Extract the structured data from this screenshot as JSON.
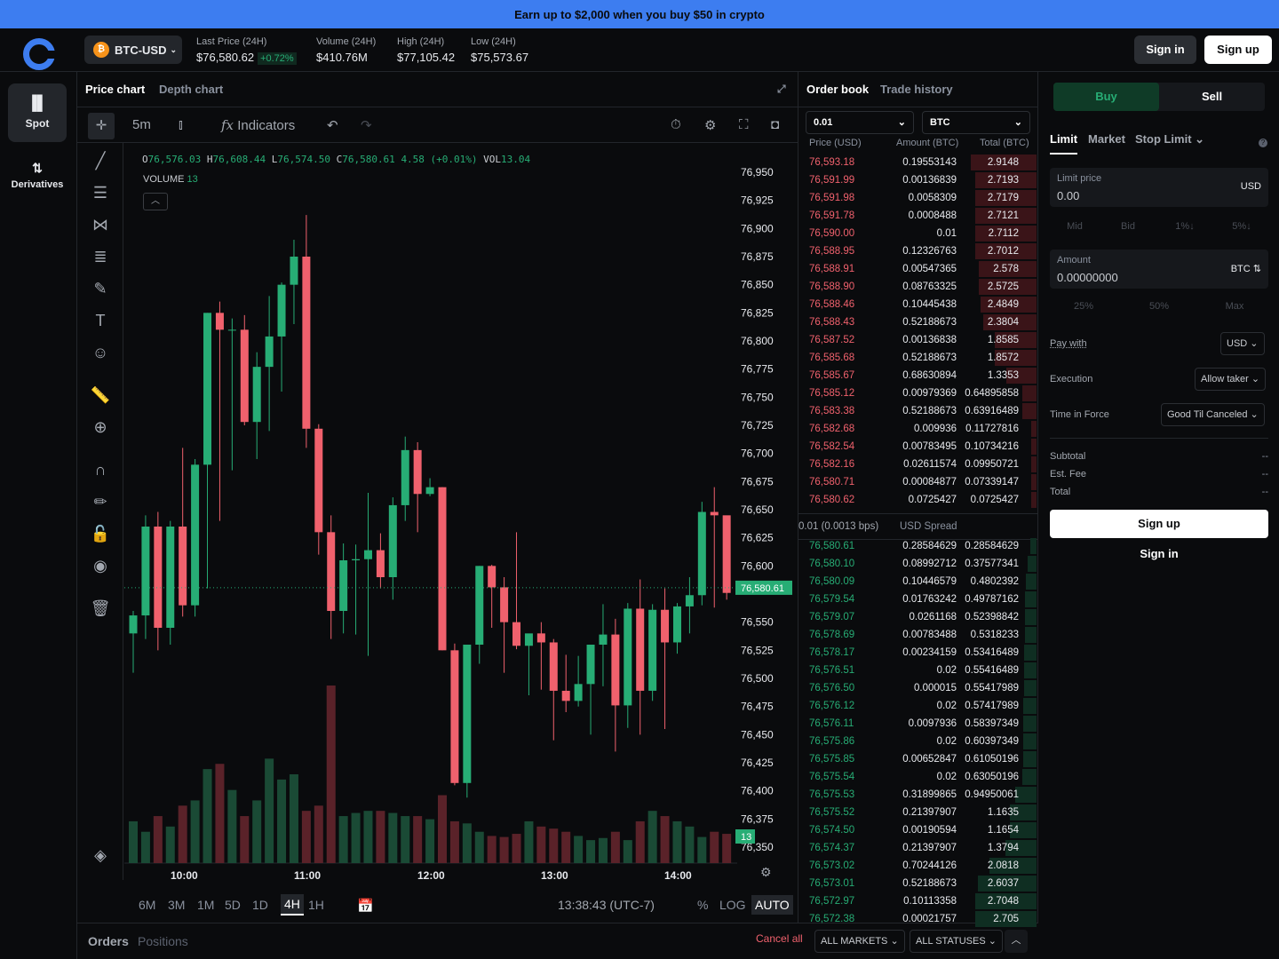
{
  "banner": {
    "text": "Earn up to $2,000 when you buy $50 in crypto"
  },
  "header": {
    "pair": "BTC-USD",
    "last_price_label": "Last Price (24H)",
    "last_price": "$76,580.62",
    "change": "+0.72%",
    "volume_label": "Volume (24H)",
    "volume": "$410.76M",
    "high_label": "High (24H)",
    "high": "$77,105.42",
    "low_label": "Low (24H)",
    "low": "$75,573.67",
    "sign_in": "Sign in",
    "sign_up": "Sign up"
  },
  "sidebar": {
    "spot": "Spot",
    "derivatives": "Derivatives"
  },
  "chart_tabs": {
    "price": "Price chart",
    "depth": "Depth chart"
  },
  "toolbar": {
    "interval": "5m",
    "indicators": "Indicators"
  },
  "legend": {
    "o": "76,576.03",
    "h": "76,608.44",
    "l": "76,574.50",
    "c": "76,580.61",
    "chg": "4.58 (+0.01%)",
    "vol": "13.04",
    "volume_label": "VOLUME",
    "volume_value": "13"
  },
  "price_axis": [
    "76,950",
    "76,925",
    "76,900",
    "76,875",
    "76,850",
    "76,825",
    "76,800",
    "76,775",
    "76,750",
    "76,725",
    "76,700",
    "76,675",
    "76,650",
    "76,625",
    "76,600",
    "76,550",
    "76,525",
    "76,500",
    "76,475",
    "76,450",
    "76,425",
    "76,400",
    "76,375",
    "76,350"
  ],
  "price_tag": "76,580.61",
  "vol_tag": "13",
  "time_axis": [
    "10:00",
    "11:00",
    "12:00",
    "13:00",
    "14:00"
  ],
  "timeframes": [
    "6M",
    "3M",
    "1M",
    "5D",
    "1D",
    "4H",
    "1H"
  ],
  "active_timeframe": "4H",
  "clock": "13:38:43 (UTC-7)",
  "scale_opts": {
    "pct": "%",
    "log": "LOG",
    "auto": "AUTO"
  },
  "orders_bar": {
    "orders": "Orders",
    "positions": "Positions",
    "cancel_all": "Cancel all",
    "all_markets": "ALL MARKETS",
    "all_statuses": "ALL STATUSES"
  },
  "orderbook": {
    "tab_book": "Order book",
    "tab_trades": "Trade history",
    "agg": "0.01",
    "unit": "BTC",
    "h_price": "Price (USD)",
    "h_amount": "Amount (BTC)",
    "h_total": "Total (BTC)",
    "spread": "0.01 (0.0013 bps)",
    "spread_label": "USD Spread",
    "asks": [
      [
        "76,593.18",
        "0.19553143",
        "2.9148"
      ],
      [
        "76,591.99",
        "0.00136839",
        "2.7193"
      ],
      [
        "76,591.98",
        "0.0058309",
        "2.7179"
      ],
      [
        "76,591.78",
        "0.0008488",
        "2.7121"
      ],
      [
        "76,590.00",
        "0.01",
        "2.7112"
      ],
      [
        "76,588.95",
        "0.12326763",
        "2.7012"
      ],
      [
        "76,588.91",
        "0.00547365",
        "2.578"
      ],
      [
        "76,588.90",
        "0.08763325",
        "2.5725"
      ],
      [
        "76,588.46",
        "0.10445438",
        "2.4849"
      ],
      [
        "76,588.43",
        "0.52188673",
        "2.3804"
      ],
      [
        "76,587.52",
        "0.00136838",
        "1.8585"
      ],
      [
        "76,585.68",
        "0.52188673",
        "1.8572"
      ],
      [
        "76,585.67",
        "0.68630894",
        "1.3353"
      ],
      [
        "76,585.12",
        "0.00979369",
        "0.64895858"
      ],
      [
        "76,583.38",
        "0.52188673",
        "0.63916489"
      ],
      [
        "76,582.68",
        "0.009936",
        "0.11727816"
      ],
      [
        "76,582.54",
        "0.00783495",
        "0.10734216"
      ],
      [
        "76,582.16",
        "0.02611574",
        "0.09950721"
      ],
      [
        "76,580.71",
        "0.00084877",
        "0.07339147"
      ],
      [
        "76,580.62",
        "0.0725427",
        "0.0725427"
      ]
    ],
    "bids": [
      [
        "76,580.61",
        "0.28584629",
        "0.28584629"
      ],
      [
        "76,580.10",
        "0.08992712",
        "0.37577341"
      ],
      [
        "76,580.09",
        "0.10446579",
        "0.4802392"
      ],
      [
        "76,579.54",
        "0.01763242",
        "0.49787162"
      ],
      [
        "76,579.07",
        "0.0261168",
        "0.52398842"
      ],
      [
        "76,578.69",
        "0.00783488",
        "0.5318233"
      ],
      [
        "76,578.17",
        "0.00234159",
        "0.53416489"
      ],
      [
        "76,576.51",
        "0.02",
        "0.55416489"
      ],
      [
        "76,576.50",
        "0.000015",
        "0.55417989"
      ],
      [
        "76,576.12",
        "0.02",
        "0.57417989"
      ],
      [
        "76,576.11",
        "0.0097936",
        "0.58397349"
      ],
      [
        "76,575.86",
        "0.02",
        "0.60397349"
      ],
      [
        "76,575.85",
        "0.00652847",
        "0.61050196"
      ],
      [
        "76,575.54",
        "0.02",
        "0.63050196"
      ],
      [
        "76,575.53",
        "0.31899865",
        "0.94950061"
      ],
      [
        "76,575.52",
        "0.21397907",
        "1.1635"
      ],
      [
        "76,574.50",
        "0.00190594",
        "1.1654"
      ],
      [
        "76,574.37",
        "0.21397907",
        "1.3794"
      ],
      [
        "76,573.02",
        "0.70244126",
        "2.0818"
      ],
      [
        "76,573.01",
        "0.52188673",
        "2.6037"
      ],
      [
        "76,572.97",
        "0.10113358",
        "2.7048"
      ],
      [
        "76,572.38",
        "0.00021757",
        "2.705"
      ]
    ]
  },
  "trade": {
    "buy": "Buy",
    "sell": "Sell",
    "tabs": [
      "Limit",
      "Market",
      "Stop Limit"
    ],
    "limit_price_label": "Limit price",
    "limit_price": "0.00",
    "limit_unit": "USD",
    "chips1": [
      "Mid",
      "Bid",
      "1%↓",
      "5%↓"
    ],
    "amount_label": "Amount",
    "amount": "0.00000000",
    "amount_unit": "BTC ⇅",
    "chips2": [
      "25%",
      "50%",
      "Max"
    ],
    "pay_with": "Pay with",
    "pay_with_val": "USD",
    "execution": "Execution",
    "execution_val": "Allow taker",
    "tif": "Time in Force",
    "tif_val": "Good Til Canceled",
    "subtotal": "Subtotal",
    "fee": "Est. Fee",
    "total": "Total",
    "dash": "--",
    "sign_up": "Sign up",
    "sign_in": "Sign in"
  },
  "colors": {
    "accent": "#3d7df0",
    "up": "#27ad75",
    "down": "#f0616d",
    "bg": "#0a0b0d"
  },
  "chart_data": {
    "type": "candlestick",
    "x": [
      "09:35",
      "09:40",
      "09:45",
      "09:50",
      "09:55",
      "10:00",
      "10:05",
      "10:10",
      "10:15",
      "10:20",
      "10:25",
      "10:30",
      "10:35",
      "10:40",
      "10:45",
      "10:50",
      "10:55",
      "11:00",
      "11:05",
      "11:10",
      "11:15",
      "11:20",
      "11:25",
      "11:30",
      "11:35",
      "11:40",
      "11:45",
      "11:50",
      "11:55",
      "12:00",
      "12:05",
      "12:10",
      "12:15",
      "12:20",
      "12:25",
      "12:30",
      "12:35",
      "12:40",
      "12:45",
      "12:50",
      "12:55",
      "13:00",
      "13:05",
      "13:10",
      "13:15",
      "13:20",
      "13:25",
      "13:30",
      "13:35"
    ],
    "ohlc": [
      [
        76540,
        76560,
        76505,
        76556
      ],
      [
        76556,
        76645,
        76535,
        76635
      ],
      [
        76635,
        76648,
        76525,
        76545
      ],
      [
        76545,
        76640,
        76530,
        76635
      ],
      [
        76635,
        76705,
        76555,
        76565
      ],
      [
        76565,
        76695,
        76555,
        76690
      ],
      [
        76690,
        76825,
        76580,
        76825
      ],
      [
        76825,
        76835,
        76640,
        76810
      ],
      [
        76810,
        76820,
        76685,
        76810
      ],
      [
        76810,
        76823,
        76725,
        76728
      ],
      [
        76728,
        76790,
        76695,
        76777
      ],
      [
        76777,
        76840,
        76720,
        76804
      ],
      [
        76804,
        76852,
        76755,
        76850
      ],
      [
        76850,
        76890,
        76815,
        76875
      ],
      [
        76875,
        76912,
        76705,
        76722
      ],
      [
        76722,
        76726,
        76610,
        76630
      ],
      [
        76630,
        76645,
        76535,
        76560
      ],
      [
        76560,
        76620,
        76540,
        76605
      ],
      [
        76605,
        76619,
        76539,
        76606
      ],
      [
        76606,
        76665,
        76520,
        76614
      ],
      [
        76614,
        76629,
        76580,
        76590
      ],
      [
        76590,
        76661,
        76570,
        76654
      ],
      [
        76654,
        76715,
        76640,
        76703
      ],
      [
        76703,
        76710,
        76630,
        76664
      ],
      [
        76664,
        76678,
        76662,
        76670
      ],
      [
        76670,
        76670,
        76525,
        76525
      ],
      [
        76525,
        76531,
        76405,
        76407
      ],
      [
        76407,
        76529,
        76394,
        76530
      ],
      [
        76530,
        76600,
        76513,
        76600
      ],
      [
        76600,
        76601,
        76545,
        76581
      ],
      [
        76581,
        76590,
        76505,
        76550
      ],
      [
        76550,
        76630,
        76526,
        76529
      ],
      [
        76529,
        76538,
        76485,
        76540
      ],
      [
        76540,
        76550,
        76490,
        76532
      ],
      [
        76532,
        76535,
        76445,
        76489
      ],
      [
        76489,
        76521,
        76470,
        76480
      ],
      [
        76480,
        76520,
        76475,
        76495
      ],
      [
        76495,
        76510,
        76450,
        76530
      ],
      [
        76530,
        76566,
        76493,
        76539
      ],
      [
        76539,
        76553,
        76435,
        76476
      ],
      [
        76476,
        76567,
        76456,
        76562
      ],
      [
        76562,
        76588,
        76450,
        76489
      ],
      [
        76489,
        76566,
        76480,
        76561
      ],
      [
        76561,
        76580,
        76455,
        76532
      ],
      [
        76532,
        76567,
        76522,
        76564
      ],
      [
        76564,
        76590,
        76540,
        76574
      ],
      [
        76574,
        76657,
        76565,
        76648
      ],
      [
        76648,
        76670,
        76563,
        76645
      ],
      [
        76645,
        76627,
        76570,
        76576
      ]
    ],
    "volume": [
      40,
      30,
      45,
      35,
      55,
      60,
      90,
      95,
      70,
      45,
      60,
      100,
      80,
      85,
      50,
      55,
      170,
      45,
      48,
      50,
      50,
      48,
      45,
      45,
      42,
      65,
      40,
      38,
      30,
      26,
      25,
      28,
      40,
      35,
      33,
      30,
      26,
      22,
      24,
      30,
      22,
      40,
      50,
      45,
      40,
      35,
      25,
      30,
      28
    ],
    "ylim": [
      76340,
      76960
    ]
  }
}
